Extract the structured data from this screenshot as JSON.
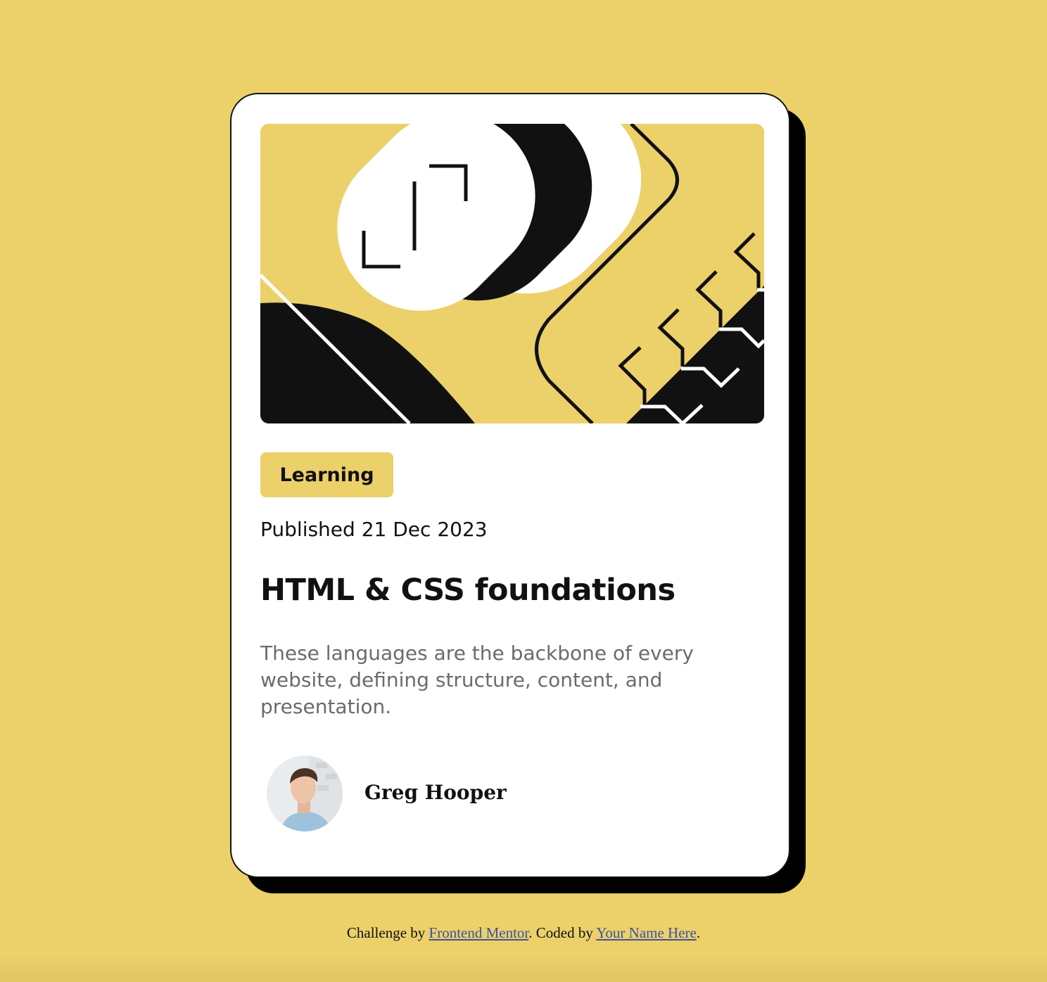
{
  "card": {
    "category": "Learning",
    "published": "Published 21 Dec 2023",
    "title": "HTML & CSS foundations",
    "description": "These languages are the backbone of every website, defining structure, content, and presentation.",
    "author_name": "Greg Hooper",
    "hero_image_icon": "abstract-illustration-icon",
    "avatar_icon": "avatar-photo-icon"
  },
  "footer": {
    "prefix": "Challenge by ",
    "link1": "Frontend Mentor",
    "middle": ". Coded by ",
    "link2": "Your Name Here",
    "suffix": "."
  },
  "colors": {
    "background": "#ecd06a",
    "card": "#ffffff",
    "text": "#111111",
    "muted": "#6b6b6b",
    "link": "#3e52a3"
  }
}
